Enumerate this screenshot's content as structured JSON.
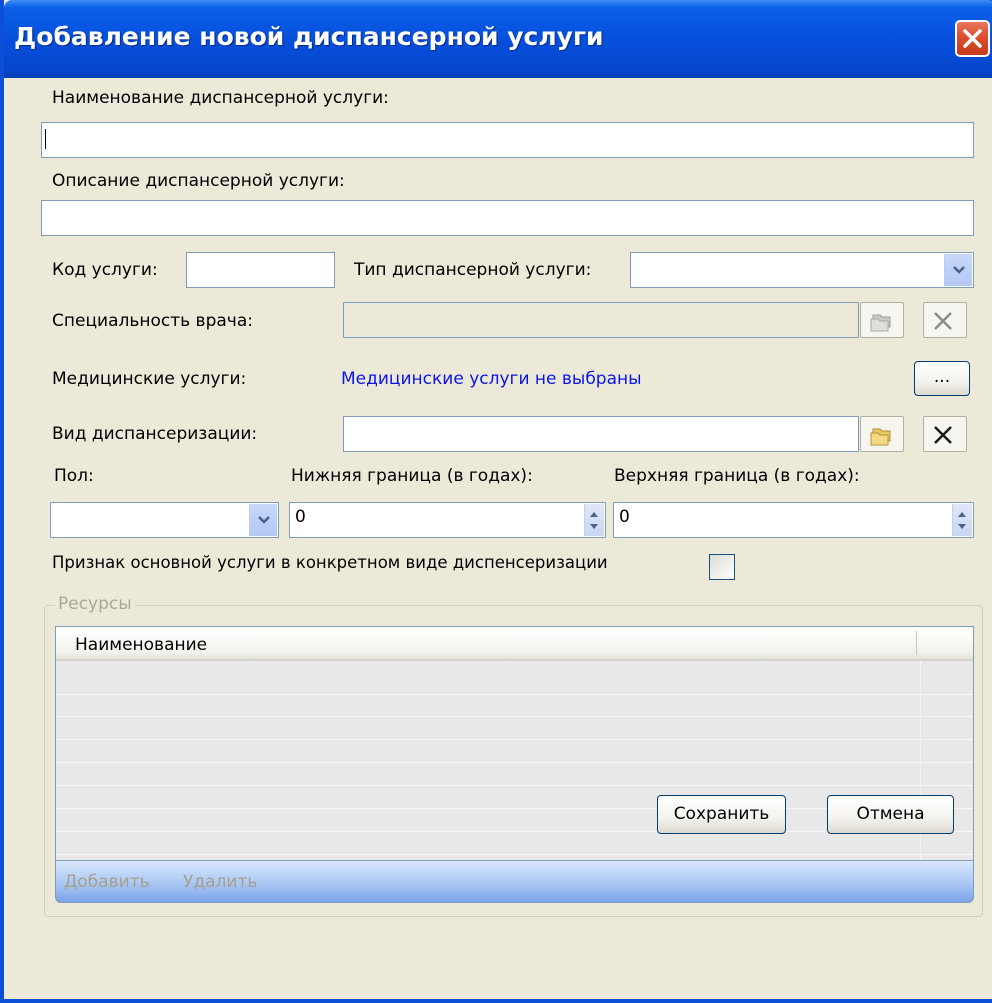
{
  "window": {
    "title": "Добавление новой диспансерной услуги"
  },
  "form": {
    "name_label": "Наименование диспансерной услуги:",
    "name_value": "",
    "description_label": "Описание диспансерной услуги:",
    "description_value": "",
    "code_label": "Код услуги:",
    "code_value": "",
    "type_label": "Тип диспансерной услуги:",
    "type_value": "",
    "specialty_label": "Специальность врача:",
    "specialty_value": "",
    "med_services_label": "Медицинские услуги:",
    "med_services_link": "Медицинские услуги не выбраны",
    "browse_button": "...",
    "dispensary_type_label": "Вид диспансеризации:",
    "dispensary_type_value": "",
    "sex_label": "Пол:",
    "sex_value": "",
    "lower_bound_label": "Нижняя граница (в годах):",
    "lower_bound_value": "0",
    "upper_bound_label": "Верхняя граница (в годах):",
    "upper_bound_value": "0",
    "main_service_label": "Признак основной услуги в конкретном виде диспенсеризации",
    "main_service_checked": false
  },
  "resources": {
    "group_title": "Ресурсы",
    "columns": [
      "Наименование"
    ],
    "rows": [],
    "add_label": "Добавить",
    "delete_label": "Удалить"
  },
  "footer": {
    "save_label": "Сохранить",
    "cancel_label": "Отмена"
  },
  "colors": {
    "titlebar": "#0650de",
    "link": "#0b16e8",
    "background": "#ece9d8",
    "disabled_text": "#a7a08e"
  }
}
